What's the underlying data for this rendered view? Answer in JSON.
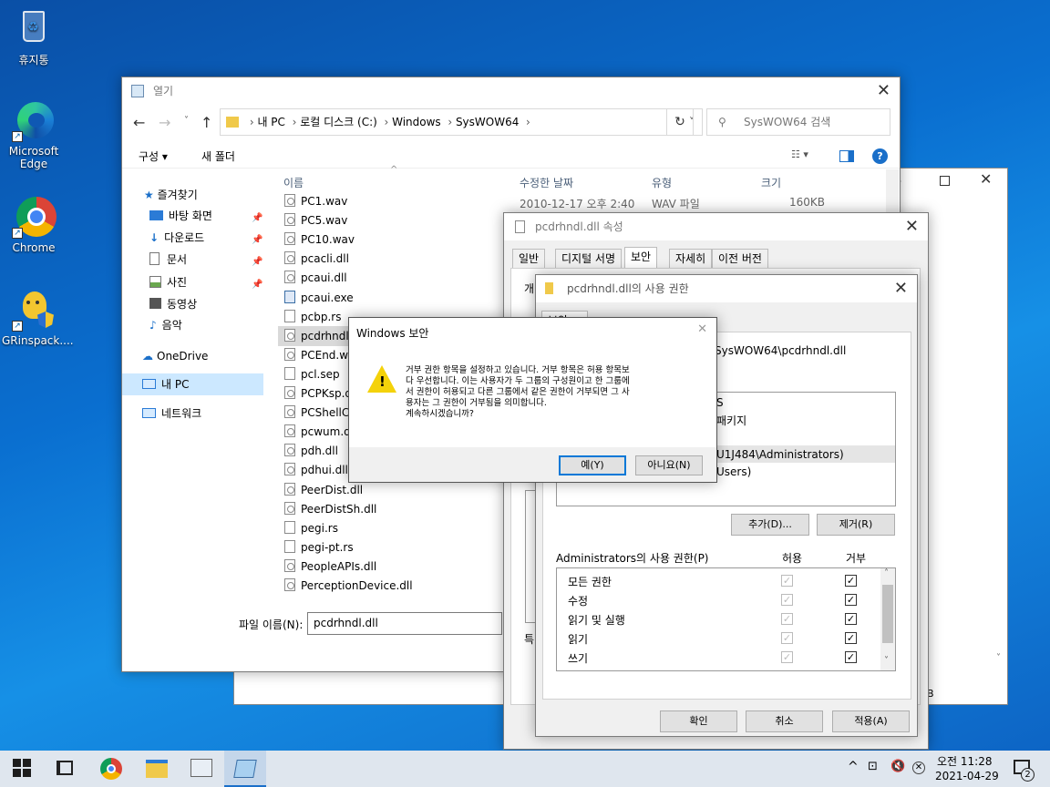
{
  "desktop": {
    "icons": [
      {
        "label": "휴지통"
      },
      {
        "label": "Microsoft Edge"
      },
      {
        "label": "Chrome"
      },
      {
        "label": "GRinspack...."
      }
    ]
  },
  "explorer": {
    "title": "열기",
    "breadcrumb": [
      "내 PC",
      "로컬 디스크 (C:)",
      "Windows",
      "SysWOW64"
    ],
    "search_placeholder": "SysWOW64 검색",
    "toolbar": {
      "organize": "구성 ▾",
      "new_folder": "새 폴더"
    },
    "nav": [
      {
        "label": "즐겨찾기"
      },
      {
        "label": "바탕 화면"
      },
      {
        "label": "다운로드"
      },
      {
        "label": "문서"
      },
      {
        "label": "사진"
      },
      {
        "label": "동영상"
      },
      {
        "label": "음악"
      },
      {
        "label": "OneDrive"
      },
      {
        "label": "내 PC"
      },
      {
        "label": "네트워크"
      }
    ],
    "columns": {
      "name": "이름",
      "date": "수정한 날짜",
      "type": "유형",
      "size": "크기"
    },
    "first_row": {
      "date": "2010-12-17 오후 2:40",
      "type": "WAV 파일",
      "size": "160KB"
    },
    "files": [
      "PC1.wav",
      "PC5.wav",
      "PC10.wav",
      "pcacli.dll",
      "pcaui.dll",
      "pcaui.exe",
      "pcbp.rs",
      "pcdrhndl.",
      "PCEnd.wa",
      "pcl.sep",
      "PCPKsp.d",
      "PCShellC",
      "pcwum.d",
      "pdh.dll",
      "pdhui.dll",
      "PeerDist.dll",
      "PeerDistSh.dll",
      "pegi.rs",
      "pegi-pt.rs",
      "PeopleAPIs.dll",
      "PerceptionDevice.dll"
    ],
    "filename_label": "파일 이름(N):",
    "filename_value": "pcdrhndl.dll"
  },
  "props": {
    "title": "pcdrhndl.dll 속성",
    "tabs": [
      "일반",
      "디지털 서명",
      "보안",
      "자세히",
      "이전 버전"
    ],
    "partial_left": [
      "개",
      "그",
      "특"
    ]
  },
  "perm": {
    "title": "pcdrhndl.dll의 사용 권한",
    "tab": "보안",
    "object_name": "SysWOW64\\pcdrhndl.dll",
    "groups": [
      "S",
      "패키지",
      "U1J484\\Administrators)",
      "Users)"
    ],
    "add": "추가(D)...",
    "remove": "제거(R)",
    "perm_header": "Administrators의 사용 권한(P)",
    "allow": "허용",
    "deny": "거부",
    "rows": [
      "모든 권한",
      "수정",
      "읽기 및 실행",
      "읽기",
      "쓰기"
    ],
    "ok": "확인",
    "cancel": "취소",
    "apply": "적용(A)"
  },
  "dialog": {
    "title": "Windows 보안",
    "lines": [
      "거부 권한 항목을 설정하고 있습니다. 거부 항목은 허용 항목보",
      "다 우선합니다. 이는 사용자가 두 그룹의 구성원이고 한 그룹에",
      "서 권한이 허용되고 다른 그룹에서 같은 권한이 거부되면 그 사",
      "용자는 그 권한이 거부됨을 의미합니다.",
      "계속하시겠습니까?"
    ],
    "yes": "예(Y)",
    "no": "아니요(N)"
  },
  "back_window": {
    "partial": "B"
  },
  "taskbar": {
    "time": "오전 11:28",
    "date": "2021-04-29",
    "notif_count": "2"
  }
}
